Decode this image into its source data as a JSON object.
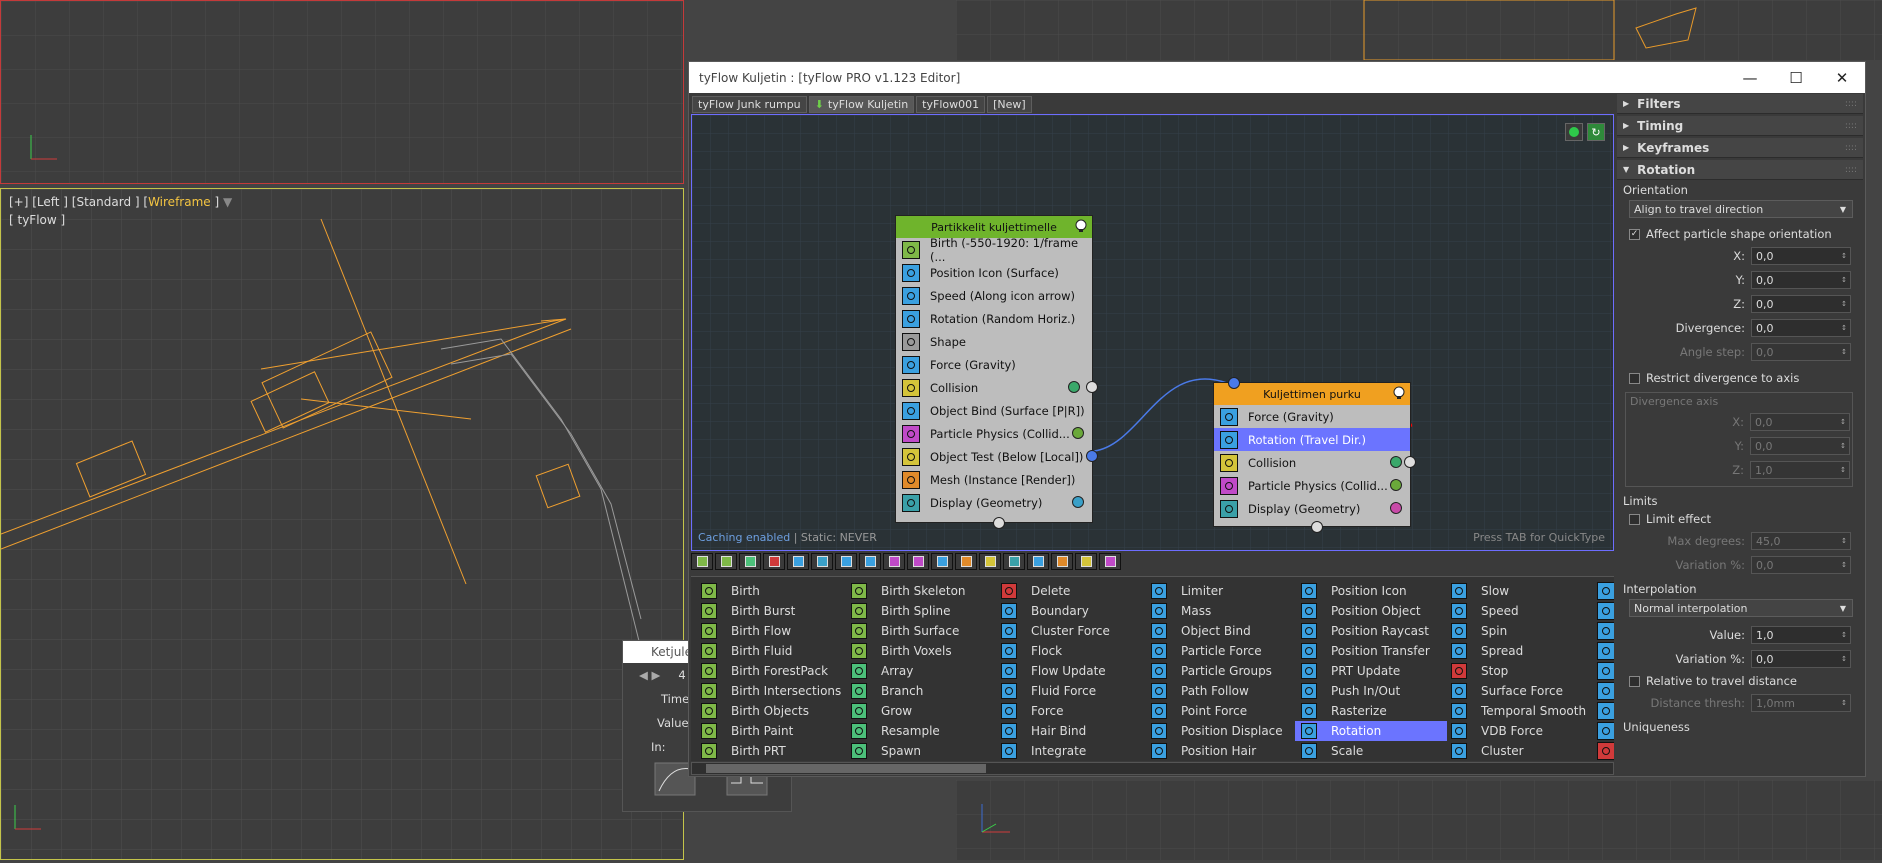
{
  "viewport_left": {
    "label_parts": [
      "[+] [Left ] [Standard ] [",
      "Wireframe",
      " ]"
    ],
    "sublabel": "[ tyFlow ]"
  },
  "window": {
    "title": "tyFlow Kuljetin : [tyFlow PRO v1.123 Editor]",
    "minimize": "—",
    "maximize": "☐",
    "close": "✕"
  },
  "tabs": [
    {
      "label": "tyFlow Junk rumpu",
      "active": false
    },
    {
      "label": "tyFlow Kuljetin",
      "active": true
    },
    {
      "label": "tyFlow001",
      "active": false
    },
    {
      "label": "[New]",
      "active": false
    }
  ],
  "canvas": {
    "caching": "Caching enabled",
    "static": " | Static: NEVER",
    "quicktype": "Press TAB for QuickType"
  },
  "event1": {
    "title": "Partikkelit kuljettimelle",
    "color": "#6fb42c",
    "operators": [
      {
        "label": "Birth (-550-1920: 1/frame (...",
        "icon": "birth-icon",
        "color": "#7fb848"
      },
      {
        "label": "Position Icon (Surface)",
        "icon": "position-icon",
        "color": "#3aa0e0"
      },
      {
        "label": "Speed (Along icon arrow)",
        "icon": "speed-icon",
        "color": "#3aa0e0"
      },
      {
        "label": "Rotation (Random Horiz.)",
        "icon": "rotation-icon",
        "color": "#3aa0e0"
      },
      {
        "label": "Shape",
        "icon": "shape-icon",
        "color": "#9a9a9a"
      },
      {
        "label": "Force (Gravity)",
        "icon": "force-icon",
        "color": "#3aa0e0"
      },
      {
        "label": "Collision",
        "icon": "collision-icon",
        "color": "#d4c43a"
      },
      {
        "label": "Object Bind (Surface [P|R])",
        "icon": "object-bind-icon",
        "color": "#3aa0e0"
      },
      {
        "label": "Particle Physics (Collid...",
        "icon": "physics-icon",
        "color": "#c04ac8"
      },
      {
        "label": "Object Test (Below [Local])",
        "icon": "object-test-icon",
        "color": "#d4c43a"
      },
      {
        "label": "Mesh (Instance [Render])",
        "icon": "mesh-icon",
        "color": "#e08a2a"
      },
      {
        "label": "Display (Geometry)",
        "icon": "display-icon",
        "color": "#3aa0a8"
      }
    ]
  },
  "event2": {
    "title": "Kuljettimen purku",
    "color": "#f0a020",
    "operators": [
      {
        "label": "Force (Gravity)",
        "icon": "force-icon",
        "color": "#3aa0e0",
        "selected": false
      },
      {
        "label": "Rotation (Travel Dir.)",
        "icon": "rotation-icon",
        "color": "#3aa0e0",
        "selected": true
      },
      {
        "label": "Collision",
        "icon": "collision-icon",
        "color": "#d4c43a",
        "selected": false
      },
      {
        "label": "Particle Physics (Collid...",
        "icon": "physics-icon",
        "color": "#c04ac8",
        "selected": false
      },
      {
        "label": "Display (Geometry)",
        "icon": "display-icon",
        "color": "#3aa0a8",
        "selected": false
      }
    ]
  },
  "depot": {
    "columns": [
      [
        {
          "label": "Birth",
          "color": "#7fb848"
        },
        {
          "label": "Birth Burst",
          "color": "#7fb848"
        },
        {
          "label": "Birth Flow",
          "color": "#7fb848"
        },
        {
          "label": "Birth Fluid",
          "color": "#7fb848"
        },
        {
          "label": "Birth ForestPack",
          "color": "#7fb848"
        },
        {
          "label": "Birth Intersections",
          "color": "#7fb848"
        },
        {
          "label": "Birth Objects",
          "color": "#7fb848"
        },
        {
          "label": "Birth Paint",
          "color": "#7fb848"
        },
        {
          "label": "Birth PRT",
          "color": "#7fb848"
        }
      ],
      [
        {
          "label": "Birth Skeleton",
          "color": "#7fb848"
        },
        {
          "label": "Birth Spline",
          "color": "#7fb848"
        },
        {
          "label": "Birth Surface",
          "color": "#7fb848"
        },
        {
          "label": "Birth Voxels",
          "color": "#7fb848"
        },
        {
          "label": "Array",
          "color": "#4cc07a"
        },
        {
          "label": "Branch",
          "color": "#4cc07a"
        },
        {
          "label": "Grow",
          "color": "#4cc07a"
        },
        {
          "label": "Resample",
          "color": "#4cc07a"
        },
        {
          "label": "Spawn",
          "color": "#4cc07a"
        }
      ],
      [
        {
          "label": "Delete",
          "color": "#d03a3a"
        },
        {
          "label": "Boundary",
          "color": "#3aa0e0"
        },
        {
          "label": "Cluster Force",
          "color": "#3aa0e0"
        },
        {
          "label": "Flock",
          "color": "#3aa0e0"
        },
        {
          "label": "Flow Update",
          "color": "#3aa0e0"
        },
        {
          "label": "Fluid Force",
          "color": "#3aa0e0"
        },
        {
          "label": "Force",
          "color": "#3aa0e0"
        },
        {
          "label": "Hair Bind",
          "color": "#3aa0e0"
        },
        {
          "label": "Integrate",
          "color": "#3aa0e0"
        }
      ],
      [
        {
          "label": "Limiter",
          "color": "#3aa0e0"
        },
        {
          "label": "Mass",
          "color": "#3aa0e0"
        },
        {
          "label": "Object Bind",
          "color": "#3aa0e0"
        },
        {
          "label": "Particle Force",
          "color": "#3aa0e0"
        },
        {
          "label": "Particle Groups",
          "color": "#3aa0e0"
        },
        {
          "label": "Path Follow",
          "color": "#3aa0e0"
        },
        {
          "label": "Point Force",
          "color": "#3aa0e0"
        },
        {
          "label": "Position Displace",
          "color": "#3aa0e0"
        },
        {
          "label": "Position Hair",
          "color": "#3aa0e0"
        }
      ],
      [
        {
          "label": "Position Icon",
          "color": "#3aa0e0",
          "selected": false
        },
        {
          "label": "Position Object",
          "color": "#3aa0e0",
          "selected": false
        },
        {
          "label": "Position Raycast",
          "color": "#3aa0e0",
          "selected": false
        },
        {
          "label": "Position Transfer",
          "color": "#3aa0e0",
          "selected": false
        },
        {
          "label": "PRT Update",
          "color": "#3aa0e0",
          "selected": false
        },
        {
          "label": "Push In/Out",
          "color": "#3aa0e0",
          "selected": false
        },
        {
          "label": "Rasterize",
          "color": "#3aa0e0",
          "selected": false
        },
        {
          "label": "Rotation",
          "color": "#3aa0e0",
          "selected": true
        },
        {
          "label": "Scale",
          "color": "#3aa0e0",
          "selected": false
        }
      ],
      [
        {
          "label": "Slow",
          "color": "#3aa0e0"
        },
        {
          "label": "Speed",
          "color": "#3aa0e0"
        },
        {
          "label": "Spin",
          "color": "#3aa0e0"
        },
        {
          "label": "Spread",
          "color": "#3aa0e0"
        },
        {
          "label": "Stop",
          "color": "#d03a3a"
        },
        {
          "label": "Surface Force",
          "color": "#3aa0e0"
        },
        {
          "label": "Temporal Smooth",
          "color": "#3aa0e0"
        },
        {
          "label": "VDB Force",
          "color": "#3aa0e0"
        },
        {
          "label": "Cluster",
          "color": "#3aa0e0"
        }
      ]
    ]
  },
  "panel": {
    "rollouts": {
      "filters": "Filters",
      "timing": "Timing",
      "keyframes": "Keyframes",
      "rotation": "Rotation"
    },
    "orientation_label": "Orientation",
    "orientation_value": "Align to travel direction",
    "affect_shape": "Affect particle shape orientation",
    "x_label": "X:",
    "x_value": "0,0",
    "y_label": "Y:",
    "y_value": "0,0",
    "z_label": "Z:",
    "z_value": "0,0",
    "divergence_label": "Divergence:",
    "divergence_value": "0,0",
    "angle_step_label": "Angle step:",
    "angle_step_value": "0,0",
    "restrict_label": "Restrict divergence to axis",
    "div_axis_title": "Divergence axis",
    "dax_x_label": "X:",
    "dax_x_value": "0,0",
    "dax_y_label": "Y:",
    "dax_y_value": "0,0",
    "dax_z_label": "Z:",
    "dax_z_value": "1,0",
    "limits_label": "Limits",
    "limit_effect": "Limit effect",
    "max_deg_label": "Max degrees:",
    "max_deg_value": "45,0",
    "variation1_label": "Variation %:",
    "variation1_value": "0,0",
    "interp_label": "Interpolation",
    "interp_value": "Normal interpolation",
    "value_label": "Value:",
    "value_value": "1,0",
    "variation2_label": "Variation %:",
    "variation2_value": "0,0",
    "relative_label": "Relative to travel distance",
    "dist_label": "Distance thresh:",
    "dist_value": "1,0mm",
    "uniqueness_label": "Uniqueness"
  },
  "ketju": {
    "title": "Ketjule",
    "frame": "4",
    "time_label": "Time:",
    "value_label": "Value:",
    "in_label": "In:"
  }
}
